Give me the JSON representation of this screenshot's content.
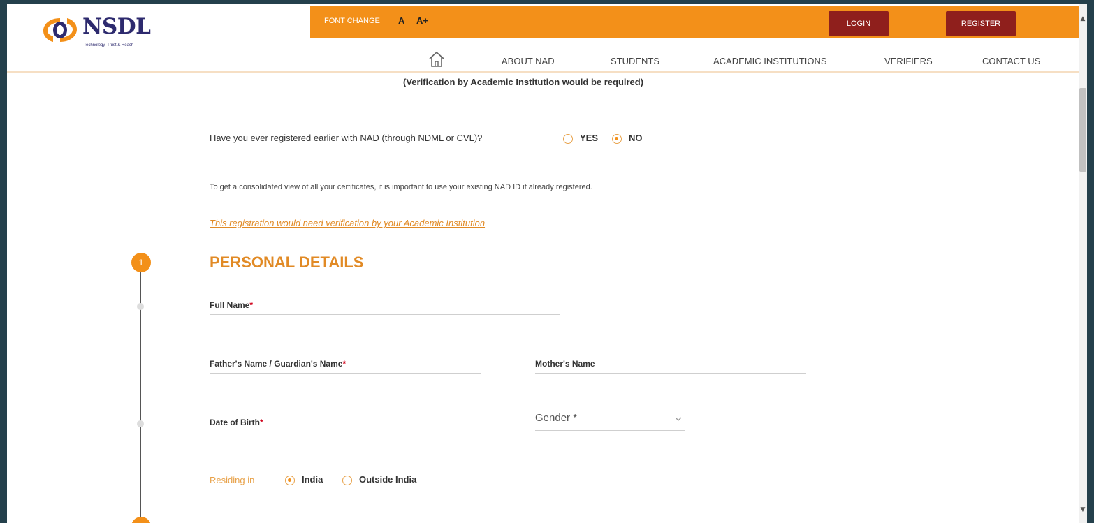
{
  "brand": {
    "name": "NSDL",
    "tagline": "Technology, Trust & Reach"
  },
  "topbar": {
    "font_change_label": "FONT CHANGE",
    "font_small": "A",
    "font_large": "A+",
    "login_label": "LOGIN",
    "register_label": "REGISTER"
  },
  "nav": {
    "items": [
      {
        "label": "ABOUT NAD"
      },
      {
        "label": "STUDENTS"
      },
      {
        "label": "ACADEMIC INSTITUTIONS"
      },
      {
        "label": "VERIFIERS"
      },
      {
        "label": "CONTACT US"
      }
    ]
  },
  "form": {
    "verification_note": "(Verification by Academic Institution would be required)",
    "registered_question": "Have you ever registered earlier with NAD (through NDML or CVL)?",
    "registered_options": [
      {
        "label": "YES",
        "selected": false
      },
      {
        "label": "NO",
        "selected": true
      }
    ],
    "consolidated_note": "To get a consolidated view of all your certificates, it is important to use your existing NAD ID if already registered.",
    "verification_link": "This registration would need verification by your Academic Institution",
    "step_number": "1",
    "section_title": "PERSONAL DETAILS",
    "fields": {
      "full_name": {
        "label": "Full Name",
        "required": "*",
        "value": ""
      },
      "father_name": {
        "label": "Father's Name / Guardian's Name",
        "required": "*",
        "value": ""
      },
      "mother_name": {
        "label": "Mother's Name",
        "value": ""
      },
      "dob": {
        "label": "Date of Birth",
        "required": "*",
        "value": ""
      },
      "gender": {
        "label": "Gender *",
        "value": ""
      }
    },
    "residing": {
      "label": "Residing in",
      "options": [
        {
          "label": "India",
          "selected": true
        },
        {
          "label": "Outside India",
          "selected": false
        }
      ]
    }
  },
  "colors": {
    "brand_orange": "#f39019",
    "button_red": "#8f1f1c",
    "brand_navy": "#2d2a6e",
    "accent_text": "#e18a25"
  }
}
